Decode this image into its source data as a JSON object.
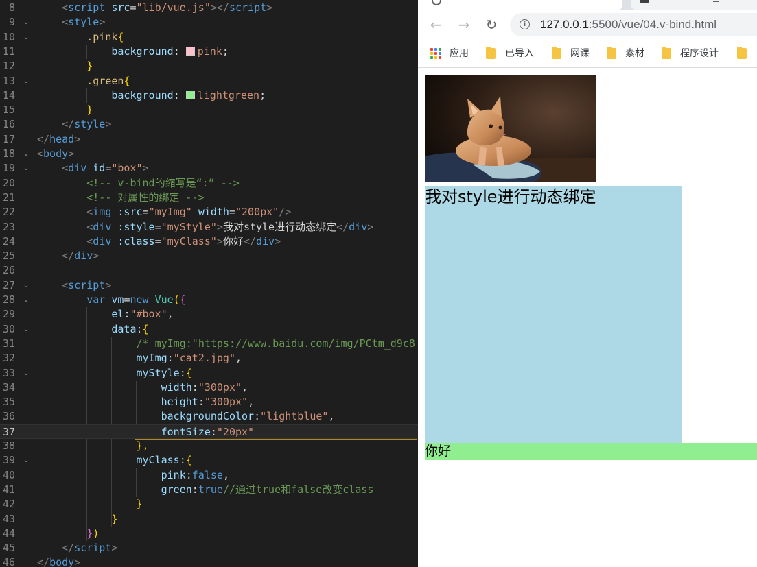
{
  "editor": {
    "lines": [
      {
        "n": "8",
        "fold": false,
        "segs": [
          [
            "t-punc",
            "    <"
          ],
          [
            "t-tag",
            "script"
          ],
          [
            "t-plain",
            " "
          ],
          [
            "t-attr",
            "src"
          ],
          [
            "t-plain",
            "="
          ],
          [
            "t-str",
            "\"lib/vue.js\""
          ],
          [
            "t-punc",
            "></"
          ],
          [
            "t-tag",
            "script"
          ],
          [
            "t-punc",
            ">"
          ]
        ]
      },
      {
        "n": "9",
        "fold": true,
        "segs": [
          [
            "t-punc",
            "    <"
          ],
          [
            "t-tag",
            "style"
          ],
          [
            "t-punc",
            ">"
          ]
        ]
      },
      {
        "n": "10",
        "fold": true,
        "segs": [
          [
            "t-sel",
            "        .pink"
          ],
          [
            "t-br1",
            "{"
          ]
        ]
      },
      {
        "n": "11",
        "fold": false,
        "segs": [
          [
            "t-prop",
            "            background"
          ],
          [
            "t-plain",
            ": "
          ],
          [
            "swatch",
            "#ffc0cb"
          ],
          [
            "t-str",
            "pink"
          ],
          [
            "t-plain",
            ";"
          ]
        ]
      },
      {
        "n": "12",
        "fold": false,
        "segs": [
          [
            "t-br1",
            "        }"
          ]
        ]
      },
      {
        "n": "13",
        "fold": true,
        "segs": [
          [
            "t-sel",
            "        .green"
          ],
          [
            "t-br1",
            "{"
          ]
        ]
      },
      {
        "n": "14",
        "fold": false,
        "segs": [
          [
            "t-prop",
            "            background"
          ],
          [
            "t-plain",
            ": "
          ],
          [
            "swatch",
            "#90ee90"
          ],
          [
            "t-str",
            "lightgreen"
          ],
          [
            "t-plain",
            ";"
          ]
        ]
      },
      {
        "n": "15",
        "fold": false,
        "segs": [
          [
            "t-br1",
            "        }"
          ]
        ]
      },
      {
        "n": "16",
        "fold": false,
        "segs": [
          [
            "t-punc",
            "    </"
          ],
          [
            "t-tag",
            "style"
          ],
          [
            "t-punc",
            ">"
          ]
        ]
      },
      {
        "n": "17",
        "fold": false,
        "segs": [
          [
            "t-punc",
            "</"
          ],
          [
            "t-tag",
            "head"
          ],
          [
            "t-punc",
            ">"
          ]
        ]
      },
      {
        "n": "18",
        "fold": true,
        "segs": [
          [
            "t-punc",
            "<"
          ],
          [
            "t-tag",
            "body"
          ],
          [
            "t-punc",
            ">"
          ]
        ]
      },
      {
        "n": "19",
        "fold": true,
        "segs": [
          [
            "t-punc",
            "    <"
          ],
          [
            "t-tag",
            "div"
          ],
          [
            "t-plain",
            " "
          ],
          [
            "t-attr",
            "id"
          ],
          [
            "t-plain",
            "="
          ],
          [
            "t-str",
            "\"box\""
          ],
          [
            "t-punc",
            ">"
          ]
        ]
      },
      {
        "n": "20",
        "fold": false,
        "segs": [
          [
            "t-com",
            "        <!-- v-bind的缩写是“:” -->"
          ]
        ]
      },
      {
        "n": "21",
        "fold": false,
        "segs": [
          [
            "t-com",
            "        <!-- 对属性的绑定 -->"
          ]
        ]
      },
      {
        "n": "22",
        "fold": false,
        "segs": [
          [
            "t-punc",
            "        <"
          ],
          [
            "t-tag",
            "img"
          ],
          [
            "t-plain",
            " "
          ],
          [
            "t-attr",
            ":src"
          ],
          [
            "t-plain",
            "="
          ],
          [
            "t-str",
            "\"myImg\""
          ],
          [
            "t-plain",
            " "
          ],
          [
            "t-attr",
            "width"
          ],
          [
            "t-plain",
            "="
          ],
          [
            "t-str",
            "\"200px\""
          ],
          [
            "t-punc",
            "/>"
          ]
        ]
      },
      {
        "n": "23",
        "fold": false,
        "segs": [
          [
            "t-punc",
            "        <"
          ],
          [
            "t-tag",
            "div"
          ],
          [
            "t-plain",
            " "
          ],
          [
            "t-attr",
            ":style"
          ],
          [
            "t-plain",
            "="
          ],
          [
            "t-str",
            "\"myStyle\""
          ],
          [
            "t-punc",
            ">"
          ],
          [
            "t-txt",
            "我对style进行动态绑定"
          ],
          [
            "t-punc",
            "</"
          ],
          [
            "t-tag",
            "div"
          ],
          [
            "t-punc",
            ">"
          ]
        ]
      },
      {
        "n": "24",
        "fold": false,
        "segs": [
          [
            "t-punc",
            "        <"
          ],
          [
            "t-tag",
            "div"
          ],
          [
            "t-plain",
            " "
          ],
          [
            "t-attr",
            ":class"
          ],
          [
            "t-plain",
            "="
          ],
          [
            "t-str",
            "\"myClass\""
          ],
          [
            "t-punc",
            ">"
          ],
          [
            "t-txt",
            "你好"
          ],
          [
            "t-punc",
            "</"
          ],
          [
            "t-tag",
            "div"
          ],
          [
            "t-punc",
            ">"
          ]
        ]
      },
      {
        "n": "25",
        "fold": false,
        "segs": [
          [
            "t-punc",
            "    </"
          ],
          [
            "t-tag",
            "div"
          ],
          [
            "t-punc",
            ">"
          ]
        ]
      },
      {
        "n": "26",
        "fold": false,
        "segs": []
      },
      {
        "n": "27",
        "fold": true,
        "segs": [
          [
            "t-punc",
            "    <"
          ],
          [
            "t-tag",
            "script"
          ],
          [
            "t-punc",
            ">"
          ]
        ]
      },
      {
        "n": "28",
        "fold": true,
        "segs": [
          [
            "t-kw",
            "        var"
          ],
          [
            "t-plain",
            " "
          ],
          [
            "t-attr",
            "vm"
          ],
          [
            "t-plain",
            "="
          ],
          [
            "t-kw",
            "new"
          ],
          [
            "t-plain",
            " "
          ],
          [
            "t-cls",
            "Vue"
          ],
          [
            "t-br1",
            "("
          ],
          [
            "t-br2",
            "{"
          ]
        ]
      },
      {
        "n": "29",
        "fold": false,
        "segs": [
          [
            "t-prop",
            "            el"
          ],
          [
            "t-plain",
            ":"
          ],
          [
            "t-str",
            "\"#box\""
          ],
          [
            "t-plain",
            ","
          ]
        ]
      },
      {
        "n": "30",
        "fold": true,
        "segs": [
          [
            "t-prop",
            "            data"
          ],
          [
            "t-plain",
            ":"
          ],
          [
            "t-br1",
            "{"
          ]
        ]
      },
      {
        "n": "31",
        "fold": false,
        "segs": [
          [
            "t-com",
            "                /* myImg:\""
          ],
          [
            "t-url",
            "https://www.baidu.com/img/PCtm_d9c8"
          ]
        ]
      },
      {
        "n": "32",
        "fold": false,
        "segs": [
          [
            "t-prop",
            "                myImg"
          ],
          [
            "t-plain",
            ":"
          ],
          [
            "t-str",
            "\"cat2.jpg\""
          ],
          [
            "t-plain",
            ","
          ]
        ]
      },
      {
        "n": "33",
        "fold": true,
        "segs": [
          [
            "t-prop",
            "                myStyle"
          ],
          [
            "t-plain",
            ":"
          ],
          [
            "t-br1",
            "{"
          ]
        ]
      },
      {
        "n": "34",
        "fold": false,
        "segs": [
          [
            "t-prop",
            "                    width"
          ],
          [
            "t-plain",
            ":"
          ],
          [
            "t-str",
            "\"300px\""
          ],
          [
            "t-plain",
            ","
          ]
        ]
      },
      {
        "n": "35",
        "fold": false,
        "segs": [
          [
            "t-prop",
            "                    height"
          ],
          [
            "t-plain",
            ":"
          ],
          [
            "t-str",
            "\"300px\""
          ],
          [
            "t-plain",
            ","
          ]
        ]
      },
      {
        "n": "36",
        "fold": false,
        "segs": [
          [
            "t-prop",
            "                    backgroundColor"
          ],
          [
            "t-plain",
            ":"
          ],
          [
            "t-str",
            "\"lightblue\""
          ],
          [
            "t-plain",
            ","
          ]
        ]
      },
      {
        "n": "37",
        "fold": false,
        "segs": [
          [
            "t-prop",
            "                    fontSize"
          ],
          [
            "t-plain",
            ":"
          ],
          [
            "t-str",
            "\"20px\""
          ]
        ]
      },
      {
        "n": "38",
        "fold": false,
        "segs": [
          [
            "t-br1",
            "                },"
          ]
        ]
      },
      {
        "n": "39",
        "fold": true,
        "segs": [
          [
            "t-prop",
            "                myClass"
          ],
          [
            "t-plain",
            ":"
          ],
          [
            "t-br1",
            "{"
          ]
        ]
      },
      {
        "n": "40",
        "fold": false,
        "segs": [
          [
            "t-prop",
            "                    pink"
          ],
          [
            "t-plain",
            ":"
          ],
          [
            "t-kw",
            "false"
          ],
          [
            "t-plain",
            ","
          ]
        ]
      },
      {
        "n": "41",
        "fold": false,
        "segs": [
          [
            "t-prop",
            "                    green"
          ],
          [
            "t-plain",
            ":"
          ],
          [
            "t-kw",
            "true"
          ],
          [
            "t-com",
            "//通过true和false改变class"
          ]
        ]
      },
      {
        "n": "42",
        "fold": false,
        "segs": [
          [
            "t-br1",
            "                }"
          ]
        ]
      },
      {
        "n": "43",
        "fold": false,
        "segs": [
          [
            "t-br1",
            "            }"
          ]
        ]
      },
      {
        "n": "44",
        "fold": false,
        "segs": [
          [
            "t-br2",
            "        }"
          ],
          [
            "t-br1",
            ")"
          ]
        ]
      },
      {
        "n": "45",
        "fold": false,
        "segs": [
          [
            "t-punc",
            "    </"
          ],
          [
            "t-tag",
            "script"
          ],
          [
            "t-punc",
            ">"
          ]
        ]
      },
      {
        "n": "46",
        "fold": false,
        "segs": [
          [
            "t-punc",
            "</"
          ],
          [
            "t-tag",
            "body"
          ],
          [
            "t-punc",
            ">"
          ]
        ]
      }
    ]
  },
  "browser": {
    "url_host": "127.0.0.1",
    "url_path": ":5500/vue/04.v-bind.html",
    "bookmarks": [
      "应用",
      "已导入",
      "网课",
      "素材",
      "程序设计"
    ],
    "page": {
      "styled_text": "我对style进行动态绑定",
      "styled_bg": "lightblue",
      "classed_text": "你好",
      "classed_bg": "lightgreen"
    }
  }
}
